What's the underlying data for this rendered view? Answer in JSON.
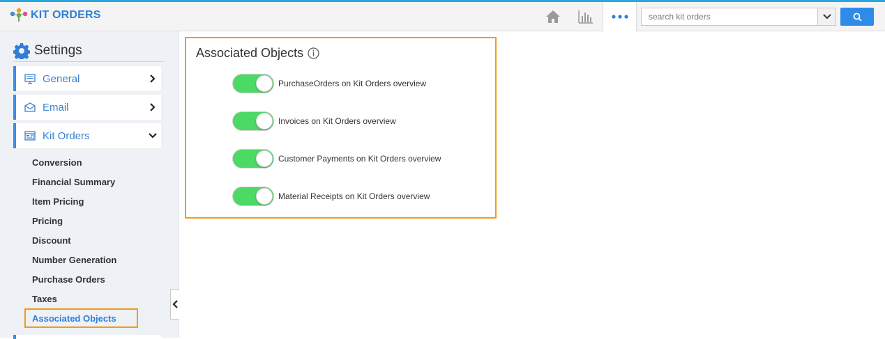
{
  "app": {
    "title": "KIT ORDERS",
    "accent_color": "#2f7ed8",
    "topbar_border_color": "#29a8e0"
  },
  "topnav": {
    "home_icon": "home-icon",
    "reports_icon": "bar-chart-icon",
    "more_icon": "more-dots-icon",
    "search": {
      "placeholder": "search kit orders",
      "value": ""
    }
  },
  "sidebar": {
    "title": "Settings",
    "menu": [
      {
        "label": "General",
        "icon": "monitor-icon",
        "expanded": false
      },
      {
        "label": "Email",
        "icon": "envelope-icon",
        "expanded": false
      },
      {
        "label": "Kit Orders",
        "icon": "window-icon",
        "expanded": true
      }
    ],
    "subitems": [
      "Conversion",
      "Financial Summary",
      "Item Pricing",
      "Pricing",
      "Discount",
      "Number Generation",
      "Purchase Orders",
      "Taxes"
    ],
    "active_subitem": "Associated Objects"
  },
  "main": {
    "title": "Associated Objects",
    "toggles": [
      {
        "label": "PurchaseOrders on Kit Orders overview",
        "on": true
      },
      {
        "label": "Invoices on Kit Orders overview",
        "on": true
      },
      {
        "label": "Customer Payments on Kit Orders overview",
        "on": true
      },
      {
        "label": "Material Receipts on Kit Orders overview",
        "on": true
      }
    ],
    "toggle_on_color": "#4cd964",
    "highlight_color": "#f39a1c"
  }
}
